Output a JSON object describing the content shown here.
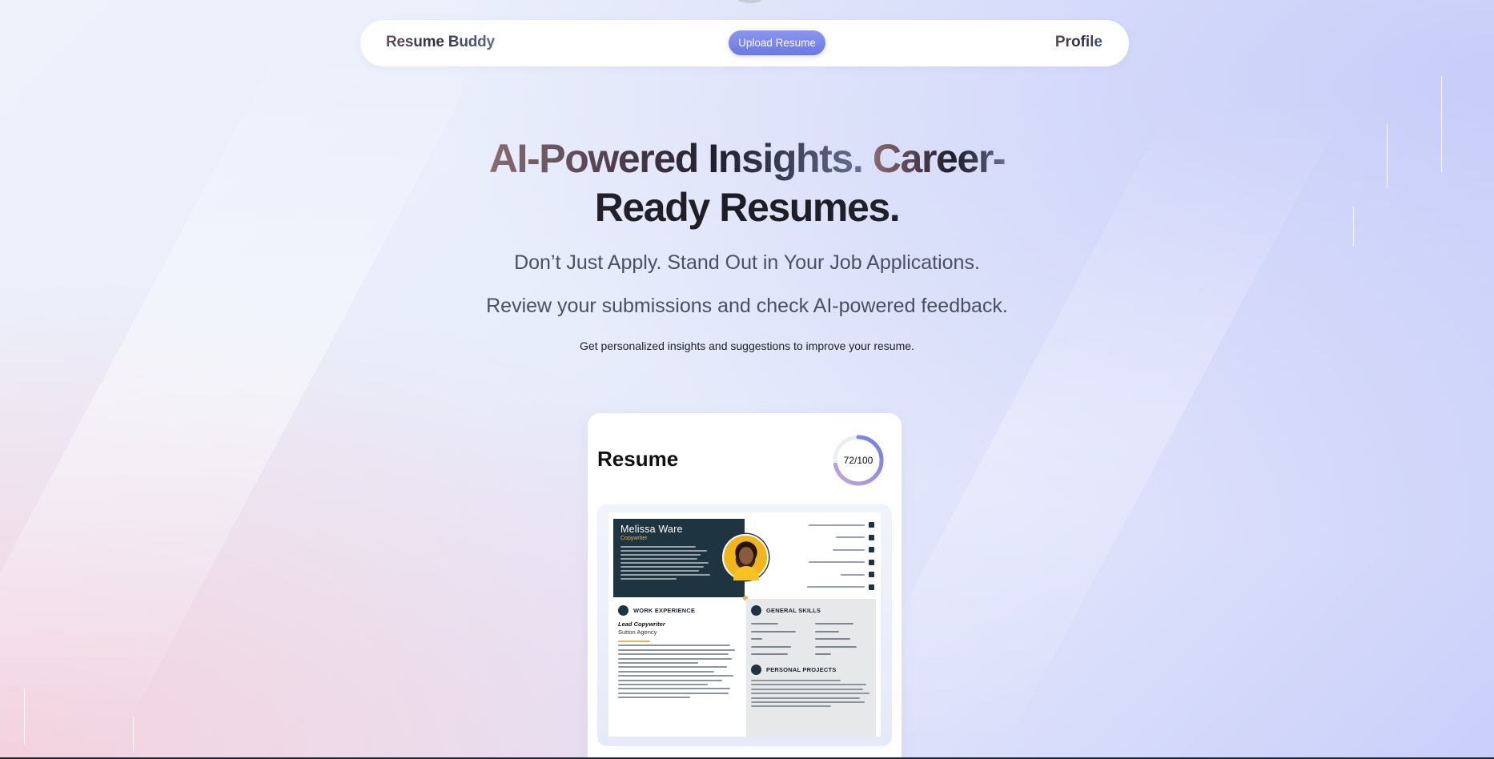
{
  "navbar": {
    "brand": "Resume Buddy",
    "upload_label": "Upload Resume",
    "profile_label": "Profile"
  },
  "hero": {
    "title_line1_part1": "AI-Powered Insights.",
    "title_line1_part2": "Career-",
    "title_line2": "Ready Resumes.",
    "subtitle1": "Don’t Just Apply. Stand Out in Your Job Applications.",
    "subtitle2": "Review your submissions and check AI-powered feedback.",
    "caption": "Get personalized insights and suggestions to improve your resume."
  },
  "resume_card": {
    "title": "Resume",
    "score_text": "72/100",
    "score_value": 72,
    "score_max": 100,
    "preview": {
      "name": "Melissa Ware",
      "role": "Copywriter",
      "section_work": "WORK EXPERIENCE",
      "job_title": "Lead Copywriter",
      "company": "Sutton Agency",
      "section_skills": "GENERAL SKILLS",
      "section_projects": "PERSONAL PROJECTS"
    }
  },
  "colors": {
    "accent": "#7480e9",
    "score_gradient_start": "#c7a6dc",
    "score_gradient_end": "#6d7ce6",
    "resume_header": "#1f3441",
    "resume_accent": "#e9b64a"
  }
}
